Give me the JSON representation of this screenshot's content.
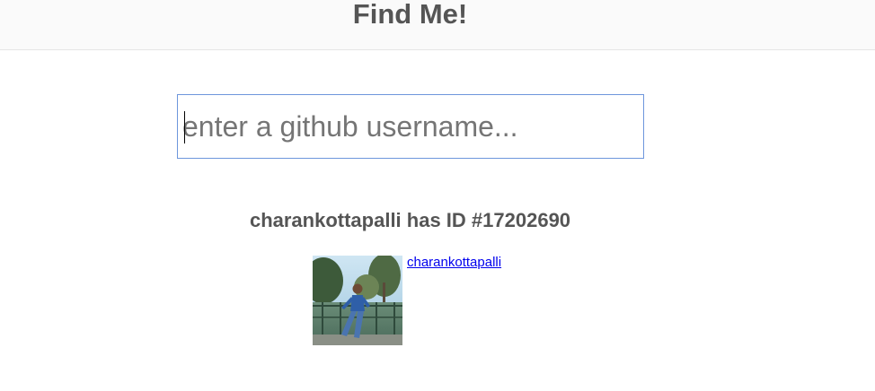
{
  "header": {
    "title": "Find Me!"
  },
  "search": {
    "placeholder": "enter a github username...",
    "value": ""
  },
  "result": {
    "heading": "charankottapalli has ID #17202690",
    "username_link": "charankottapalli",
    "avatar_icon": "user-avatar-photo"
  },
  "colors": {
    "title_text": "#555555",
    "input_border": "#6d96dc",
    "link": "#0000ee",
    "header_bg": "#fafafa"
  }
}
